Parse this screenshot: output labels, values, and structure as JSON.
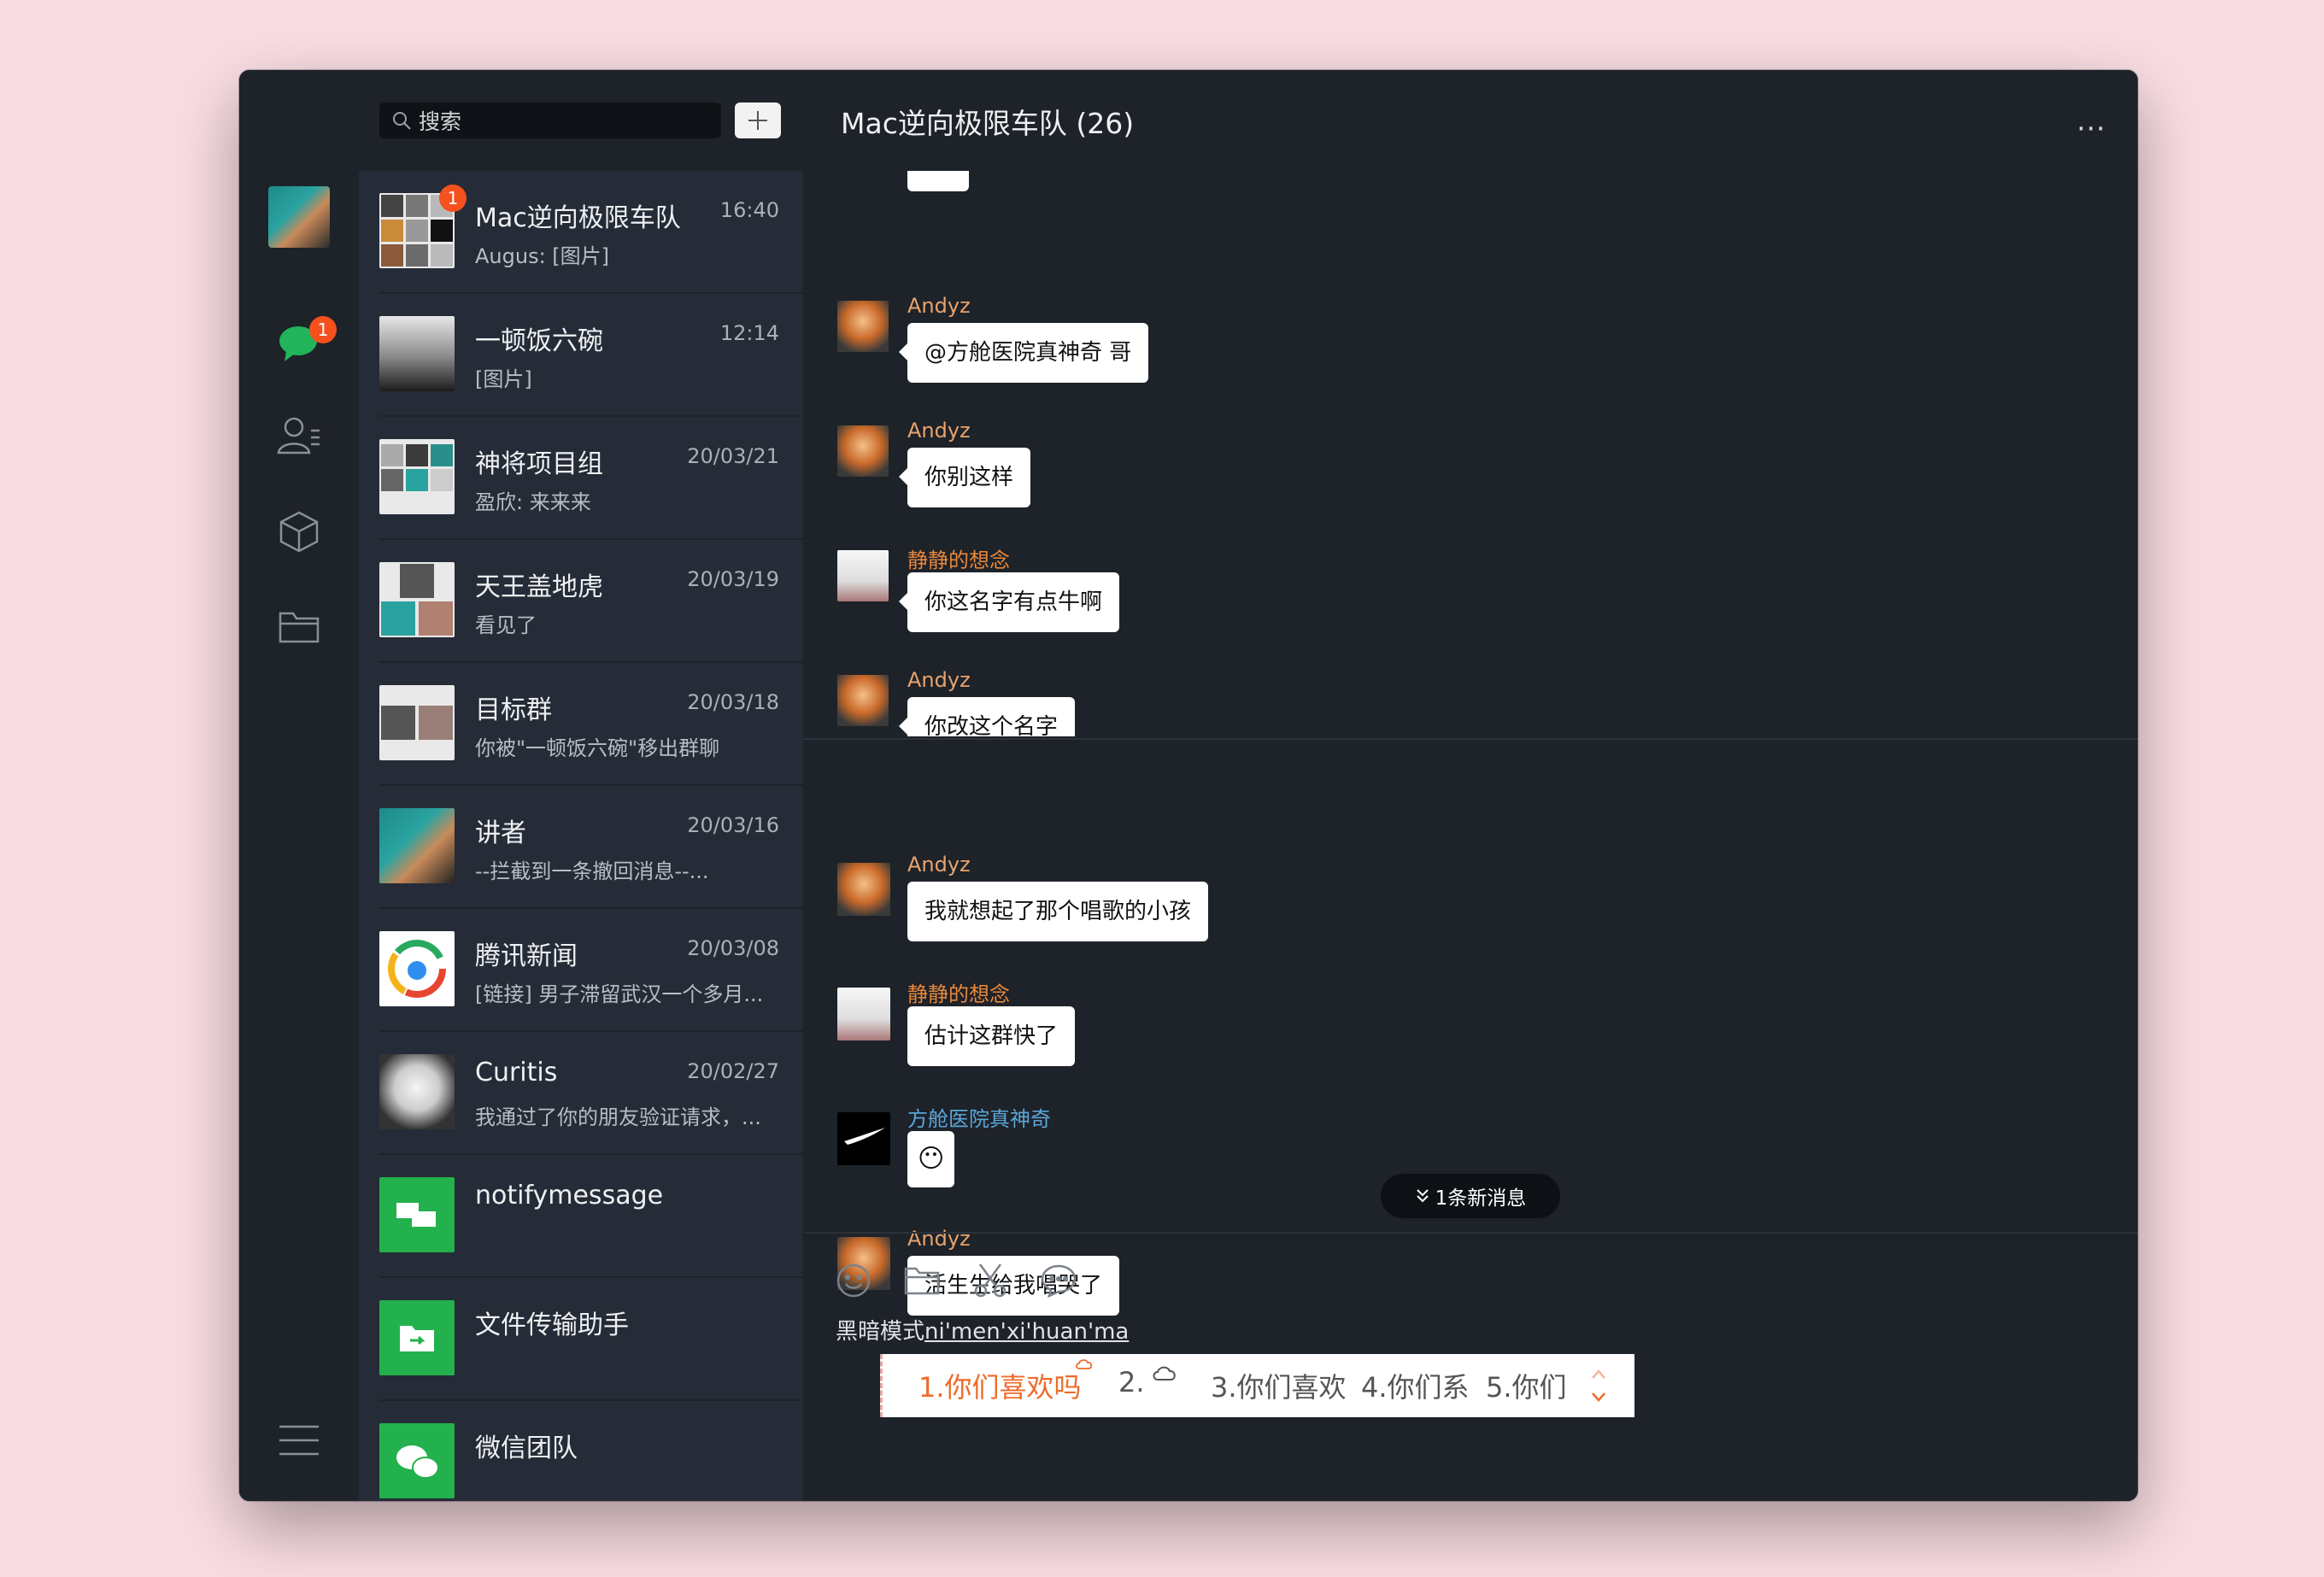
{
  "window": {
    "colors": {
      "bg": "#1e2229",
      "list_bg": "#252c37",
      "accent_badge": "#f4511e",
      "name_orange": "#e8a36b",
      "name_blue": "#5aa6d8"
    }
  },
  "search": {
    "placeholder": "搜索",
    "icon": "search-icon"
  },
  "add_button": {
    "icon": "plus-icon"
  },
  "rail": {
    "chat_badge": "1",
    "icons": [
      "chat-icon",
      "contacts-icon",
      "cube-icon",
      "folder-icon",
      "menu-icon"
    ]
  },
  "conversations": [
    {
      "name": "Mac逆向极限车队",
      "time": "16:40",
      "preview": "Augus: [图片]",
      "badge": "1"
    },
    {
      "name": "一顿饭六碗",
      "time": "12:14",
      "preview": "[图片]"
    },
    {
      "name": "神将项目组",
      "time": "20/03/21",
      "preview": "盈欣: 来来来"
    },
    {
      "name": "天王盖地虎",
      "time": "20/03/19",
      "preview": "看见了"
    },
    {
      "name": "目标群",
      "time": "20/03/18",
      "preview": "你被\"一顿饭六碗\"移出群聊"
    },
    {
      "name": "讲者",
      "time": "20/03/16",
      "preview": "--拦截到一条撤回消息--..."
    },
    {
      "name": "腾讯新闻",
      "time": "20/03/08",
      "preview": "[链接] 男子滞留武汉一个多月..."
    },
    {
      "name": "Curitis",
      "time": "20/02/27",
      "preview": "我通过了你的朋友验证请求，..."
    },
    {
      "name": "notifymessage",
      "time": "",
      "preview": ""
    },
    {
      "name": "文件传输助手",
      "time": "",
      "preview": ""
    },
    {
      "name": "微信团队",
      "time": "",
      "preview": ""
    }
  ],
  "chat": {
    "title": "Mac逆向极限车队 (26)",
    "more": "⋯",
    "messages": [
      {
        "sender": "Andyz",
        "text": "@方舱医院真神奇 哥"
      },
      {
        "sender": "Andyz",
        "text": "你别这样"
      },
      {
        "sender": "静静的想念",
        "text": "你这名字有点牛啊"
      },
      {
        "sender": "Andyz",
        "text": "你改这个名字"
      },
      {
        "sender": "Andyz",
        "text": "我就想起了那个唱歌的小孩"
      },
      {
        "sender": "静静的想念",
        "text": "估计这群快了"
      },
      {
        "sender": "方舱医院真神奇",
        "text": "😶"
      },
      {
        "sender": "Andyz",
        "text": "活生生给我唱哭了"
      }
    ],
    "new_message_pill": "1条新消息",
    "toolbar_icons": [
      "emoji-icon",
      "folder-icon",
      "scissors-icon",
      "chat-bubble-icon"
    ],
    "input": {
      "prefix": "黑暗模式",
      "composing": "ni'men'xi'huan'ma"
    }
  },
  "ime": {
    "candidates": [
      "1.你们喜欢吗",
      "2.",
      "3.你们喜欢",
      "4.你们系",
      "5.你们"
    ]
  }
}
